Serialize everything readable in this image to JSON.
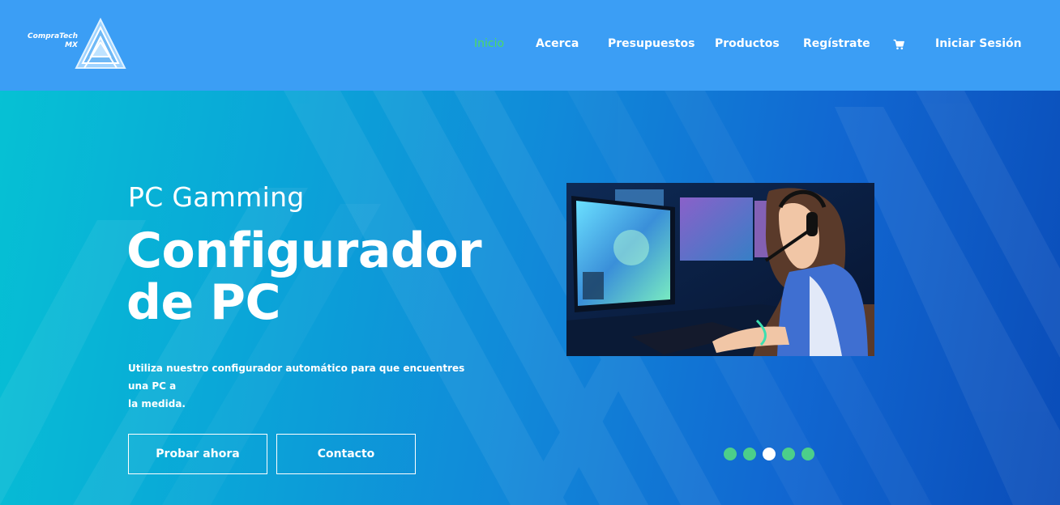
{
  "brand": {
    "name_line1": "CompraTech",
    "name_line2": "MX",
    "logo_icon": "triangle-logo-icon"
  },
  "nav": {
    "items": [
      {
        "label": "Inicio",
        "active": true
      },
      {
        "label": "Acerca",
        "active": false
      },
      {
        "label": "Presupuestos",
        "active": false
      },
      {
        "label": "Productos",
        "active": false
      },
      {
        "label": "Regístrate",
        "active": false
      },
      {
        "label": "",
        "icon": "cart-icon",
        "active": false
      },
      {
        "label": "Iniciar Sesión",
        "active": false
      }
    ],
    "active_color": "#4cd964"
  },
  "hero": {
    "subtitle": "PC Gamming",
    "title_line1": "Configurador",
    "title_line2": "de PC",
    "description_line1": "Utiliza nuestro configurador automático para que encuentres una PC a",
    "description_line2": "la medida.",
    "primary_button": "Probar ahora",
    "secondary_button": "Contacto",
    "image_icon": "gamer-photo",
    "carousel": {
      "count": 5,
      "active_index": 2,
      "dot_color": "#4ccf8a",
      "active_color": "#ffffff"
    }
  },
  "colors": {
    "header_bg": "#3b9ef5",
    "hero_gradient_start": "#06c1d4",
    "hero_gradient_end": "#0a4cb8"
  }
}
